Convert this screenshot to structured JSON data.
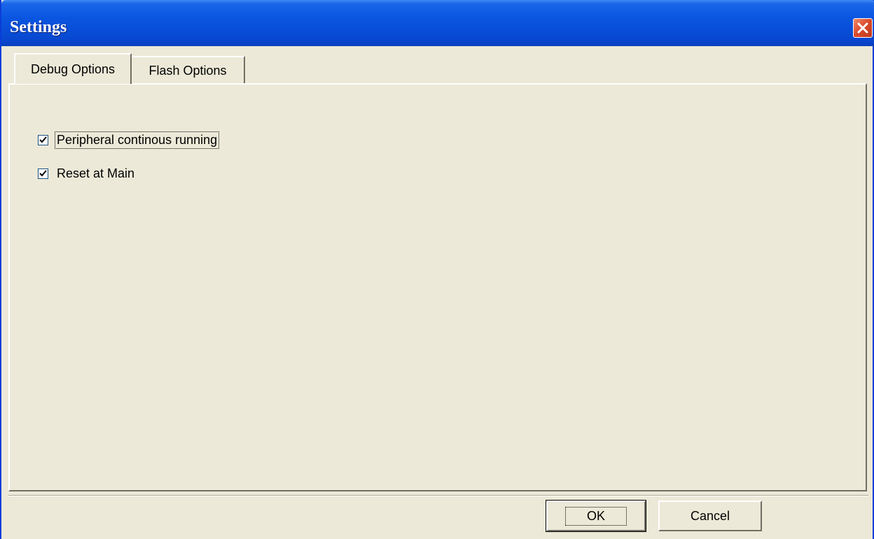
{
  "window": {
    "title": "Settings",
    "close_icon": "close-icon",
    "accent_color": "#0a55e0",
    "close_color": "#d9482a"
  },
  "tabs": [
    {
      "label": "Debug Options",
      "active": true
    },
    {
      "label": "Flash Options",
      "active": false
    }
  ],
  "debug_options": {
    "checkboxes": [
      {
        "label": "Peripheral continous running",
        "checked": true
      },
      {
        "label": "Reset at Main",
        "checked": true
      }
    ]
  },
  "footer": {
    "ok_label": "OK",
    "cancel_label": "Cancel"
  }
}
